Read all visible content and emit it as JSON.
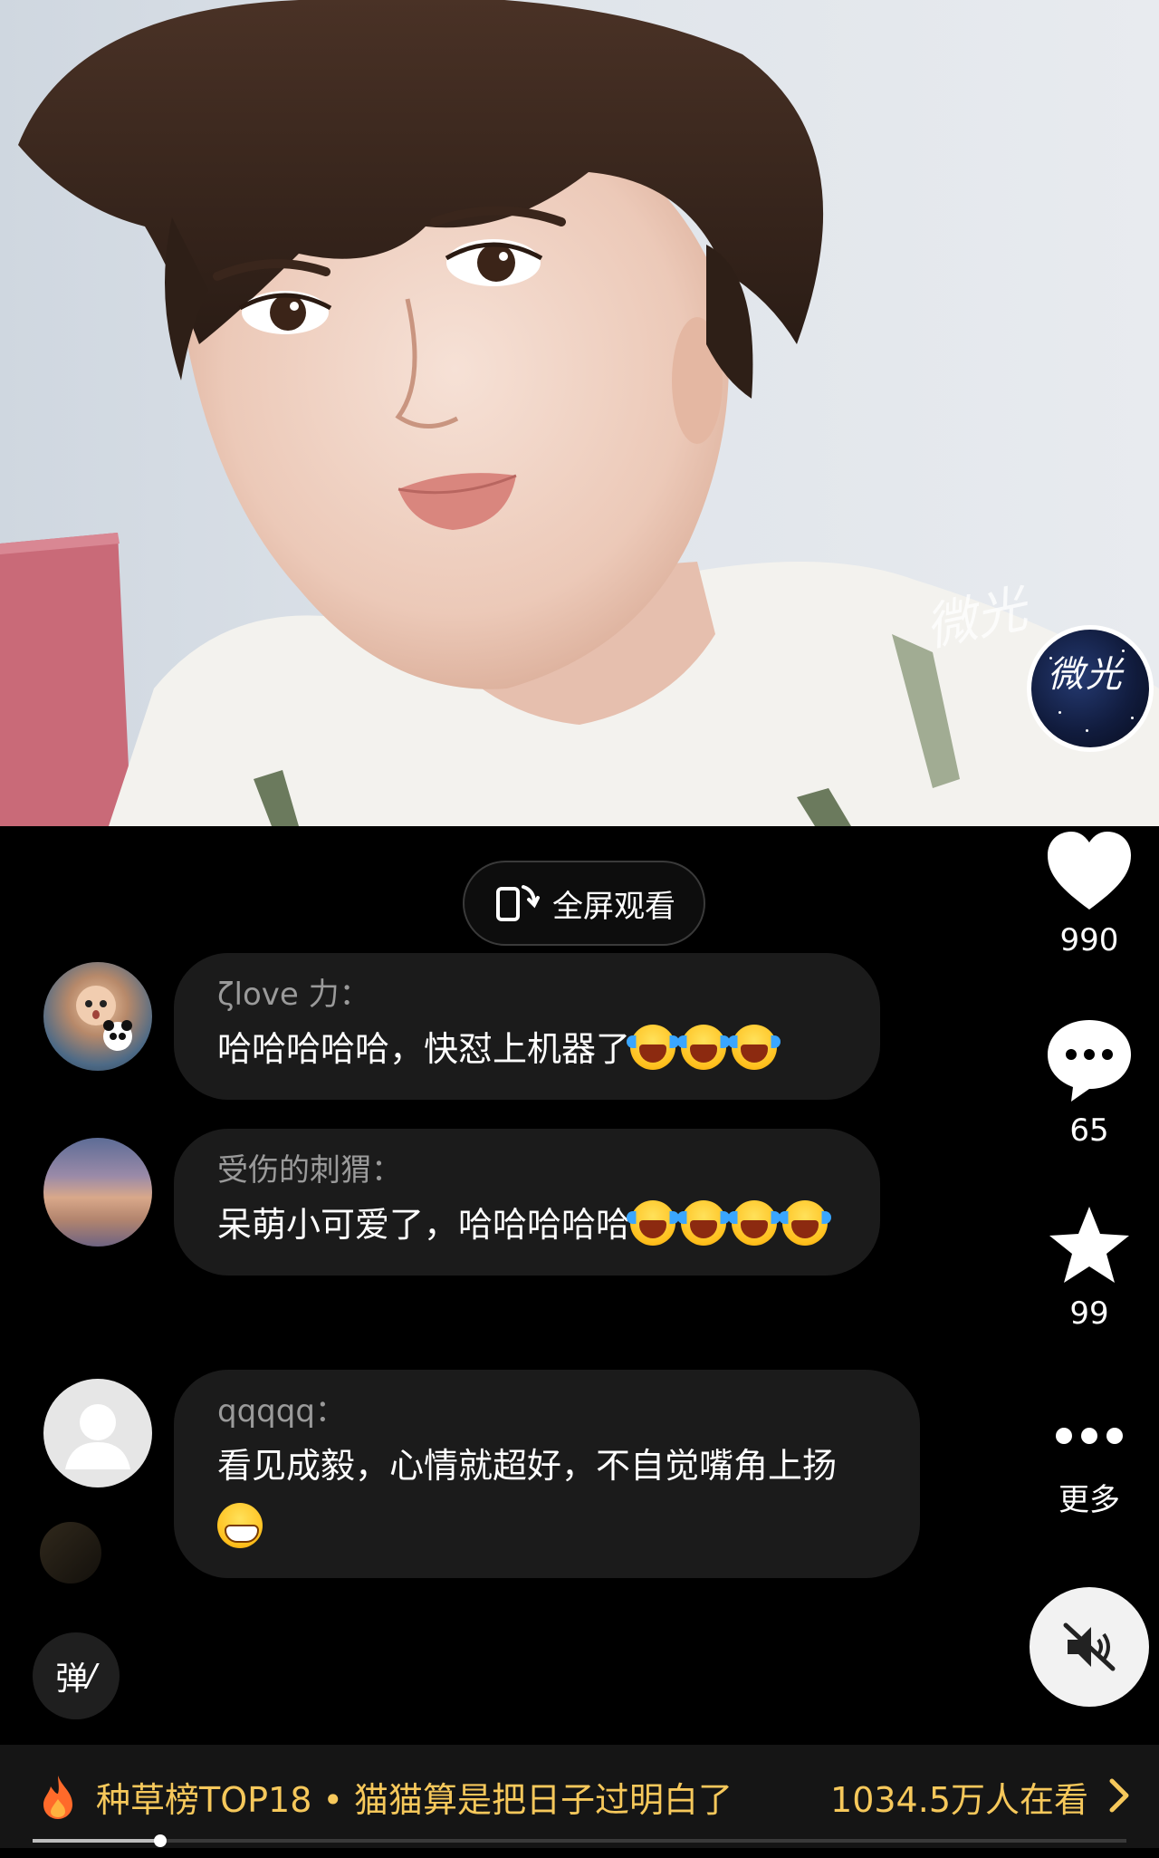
{
  "video": {
    "badge_signature": "微光",
    "watermark": "微光"
  },
  "fullscreen": {
    "label": "全屏观看"
  },
  "comments": [
    {
      "user": "ζlove 力：",
      "text": "哈哈哈哈哈，快怼上机器了",
      "emojis": [
        "laugh",
        "laugh",
        "laugh"
      ]
    },
    {
      "user": "受伤的刺猬：",
      "text": "呆萌小可爱了，哈哈哈哈哈",
      "emojis": [
        "laugh",
        "laugh",
        "laugh",
        "laugh"
      ]
    },
    {
      "user": "qqqqq：",
      "text": "看见成毅，心情就超好，不自觉嘴角上扬",
      "emojis": [
        "grin"
      ]
    }
  ],
  "sidebar": {
    "like_count": "990",
    "comment_count": "65",
    "favorite_count": "99",
    "more_label": "更多"
  },
  "danmu": {
    "label": "弹"
  },
  "bottom_bar": {
    "topic": "种草榜TOP18 • 猫猫算是把日子过明白了",
    "viewers": "1034.5万人在看"
  },
  "progress": {
    "played_fraction": 0.117
  },
  "colors": {
    "accent_gold": "#f6c85b",
    "background": "#000000",
    "bubble": "#1b1b1b",
    "username_gray": "#9a9a9a"
  }
}
